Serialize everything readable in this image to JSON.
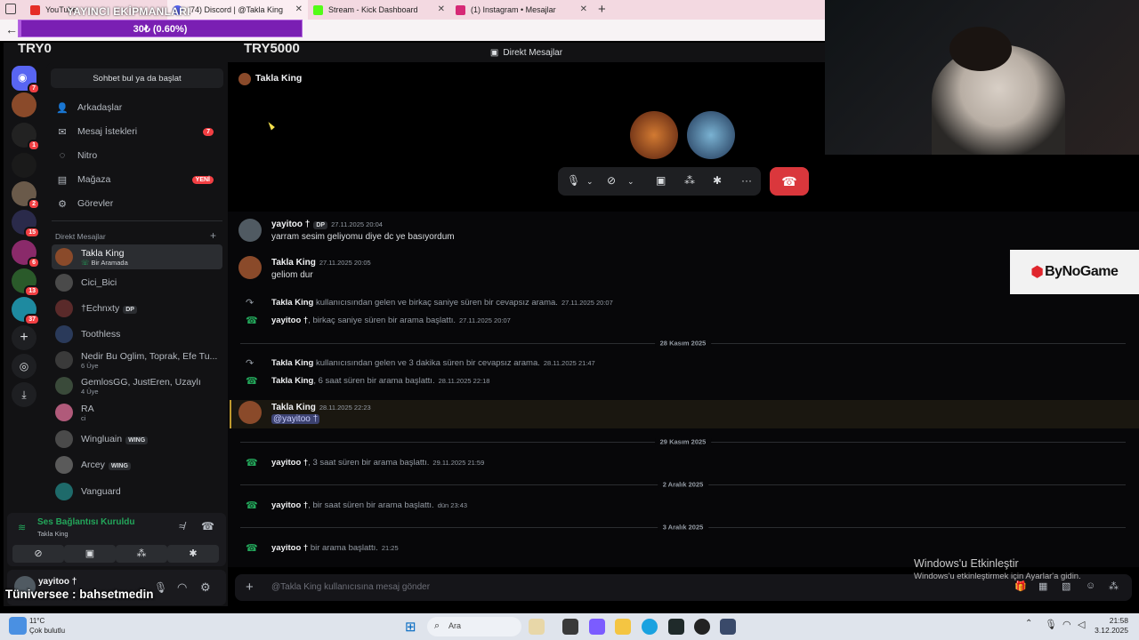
{
  "browser": {
    "tabs": [
      {
        "label": "YouTube",
        "color": "#e52d27"
      },
      {
        "label": "(74) Discord | @Takla King",
        "color": "#5865f2"
      },
      {
        "label": "Stream - Kick Dashboard",
        "color": "#53fc18"
      },
      {
        "label": "(1) Instagram • Mesajlar",
        "color": "#d62976"
      }
    ]
  },
  "overlay": {
    "donate_title": "YAYINCI EKİPMANLARI",
    "donate_progress": "30₺ (0.60%)",
    "progress_fraction": 0.006,
    "try_left": "TRY0",
    "try_right": "TRY5000",
    "universe_text": "Tüniversee : bahsetmedin",
    "bynogame": "ByNoGame"
  },
  "discord": {
    "top_title": "Direkt Mesajlar",
    "search_button": "Sohbet bul ya da başlat",
    "nav": [
      {
        "label": "Arkadaşlar",
        "icon": "friends-icon"
      },
      {
        "label": "Mesaj İstekleri",
        "icon": "mail-icon",
        "badge": "7"
      },
      {
        "label": "Nitro",
        "icon": "nitro-icon"
      },
      {
        "label": "Mağaza",
        "icon": "shop-icon",
        "badge": "YENİ"
      },
      {
        "label": "Görevler",
        "icon": "quests-icon"
      }
    ],
    "dm_header": "Direkt Mesajlar",
    "server_badges": [
      "7",
      "1",
      "2",
      "15",
      "6",
      "13",
      "37"
    ],
    "dms": [
      {
        "name": "Takla King",
        "sub": "Bir Aramada",
        "color": "#8a4a2a"
      },
      {
        "name": "Cici_Bici",
        "sub": "",
        "color": "#4a4a4a"
      },
      {
        "name": "†Echnxty",
        "tag": "DP",
        "sub": "",
        "color": "#5a2a2a"
      },
      {
        "name": "Toothless",
        "sub": "",
        "color": "#2a3a5a"
      },
      {
        "name": "Nedir Bu Oglim, Toprak, Efe Tu...",
        "sub": "6 Üye",
        "color": "#3a3a3a"
      },
      {
        "name": "GemlosGG, JustEren, Uzaylı",
        "sub": "4 Üye",
        "color": "#3a4a3a"
      },
      {
        "name": "RA",
        "sub": "ci",
        "color": "#b05a7a"
      },
      {
        "name": "Wingluain",
        "tag": "WING",
        "sub": "",
        "color": "#4a4a4a"
      },
      {
        "name": "Arcey",
        "tag": "WING",
        "sub": "",
        "color": "#5a5a5a"
      },
      {
        "name": "Vanguard",
        "sub": "",
        "color": "#1e6a6a"
      }
    ],
    "voice": {
      "status": "Ses Bağlantısı Kuruldu",
      "channel": "Takla King"
    },
    "user": {
      "name": "yayitoo †"
    },
    "chat_header": "Takla King",
    "messages": {
      "m1_author": "yayitoo †",
      "m1_tag": "DP",
      "m1_time": "27.11.2025 20:04",
      "m1_text": "yarram sesim geliyomu diye dc ye basıyordum",
      "m2_author": "Takla King",
      "m2_time": "27.11.2025 20:05",
      "m2_text": "geliom dur",
      "s1_name": "Takla King",
      "s1_text": "kullanıcısından gelen ve birkaç saniye süren bir cevapsız arama.",
      "s1_time": "27.11.2025 20:07",
      "s2_name": "yayitoo †",
      "s2_text": ", birkaç saniye süren bir arama başlattı.",
      "s2_time": "27.11.2025 20:07",
      "d1": "28 Kasım 2025",
      "s3_name": "Takla King",
      "s3_text": "kullanıcısından gelen ve 3 dakika süren bir cevapsız arama.",
      "s3_time": "28.11.2025 21:47",
      "s4_name": "Takla King",
      "s4_text": ", 6 saat süren bir arama başlattı.",
      "s4_time": "28.11.2025 22:18",
      "m3_author": "Takla King",
      "m3_time": "28.11.2025 22:23",
      "m3_mention": "@yayitoo †",
      "d2": "29 Kasım 2025",
      "s5_name": "yayitoo †",
      "s5_text": ", 3 saat süren bir arama başlattı.",
      "s5_time": "29.11.2025 21:59",
      "d3": "2 Aralık 2025",
      "s6_name": "yayitoo †",
      "s6_text": ", bir saat süren bir arama başlattı.",
      "s6_time": "dün 23:43",
      "d4": "3 Aralık 2025",
      "s7_name": "yayitoo †",
      "s7_text": "bir arama başlattı.",
      "s7_time": "21:25"
    },
    "input_placeholder": "@Takla King kullanıcısına mesaj gönder"
  },
  "windows": {
    "activate_title": "Windows'u Etkinleştir",
    "activate_sub": "Windows'u etkinleştirmek için Ayarlar'a gidin.",
    "weather_temp": "11°C",
    "weather_desc": "Çok bulutlu",
    "search": "Ara",
    "time": "21:58",
    "date": "3.12.2025"
  }
}
